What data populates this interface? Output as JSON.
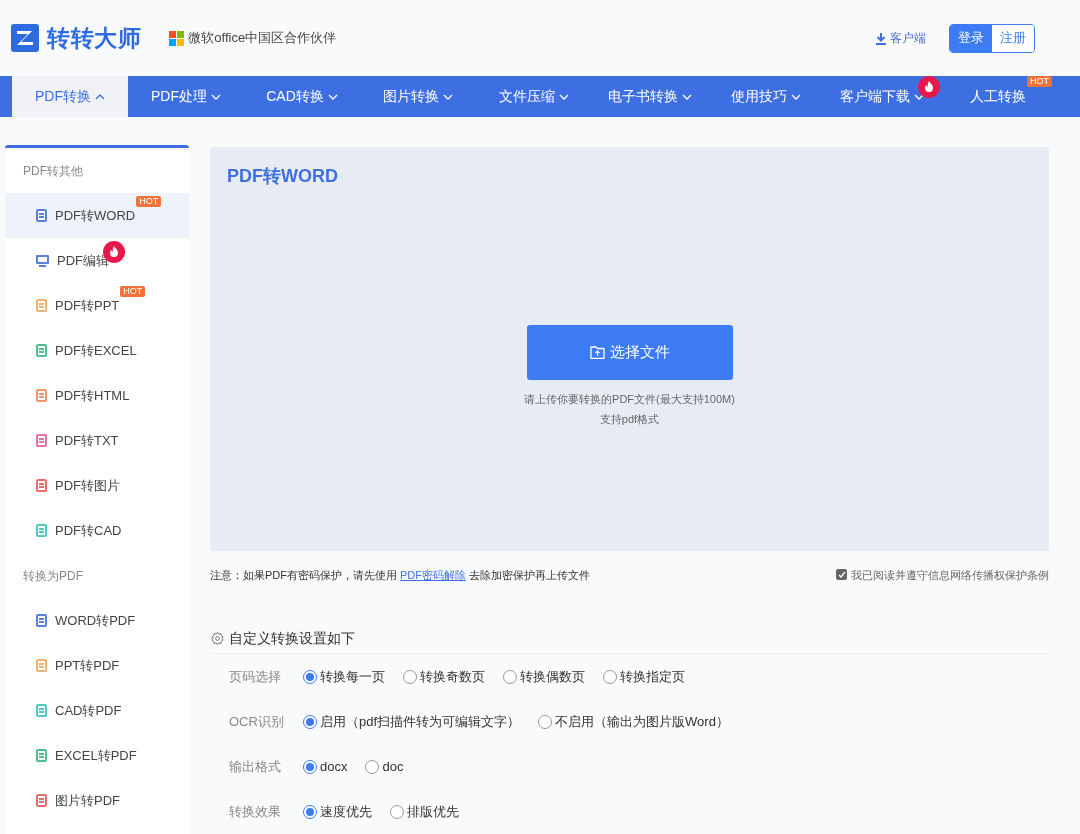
{
  "header": {
    "brand": "转转大师",
    "partner": "微软office中国区合作伙伴",
    "client_link": "客户端",
    "login": "登录",
    "register": "注册"
  },
  "nav": [
    {
      "label": "PDF转换",
      "selected": true,
      "expanded": true
    },
    {
      "label": "PDF处理",
      "selected": false,
      "expanded": false
    },
    {
      "label": "CAD转换",
      "selected": false,
      "expanded": false
    },
    {
      "label": "图片转换",
      "selected": false,
      "expanded": false
    },
    {
      "label": "文件压缩",
      "selected": false,
      "expanded": false
    },
    {
      "label": "电子书转换",
      "selected": false,
      "expanded": false
    },
    {
      "label": "使用技巧",
      "selected": false,
      "expanded": false
    },
    {
      "label": "客户端下载",
      "selected": false,
      "expanded": false,
      "badge": {
        "kind": "fire"
      }
    },
    {
      "label": "人工转换",
      "selected": false,
      "badge": {
        "kind": "hot",
        "text": "HOT"
      }
    }
  ],
  "sidebar": [
    {
      "title": "PDF转其他",
      "items": [
        {
          "label": "PDF转WORD",
          "selected": true,
          "kind": "doc",
          "color": "#5b7fe0",
          "badge": {
            "kind": "hot",
            "text": "HOT"
          }
        },
        {
          "label": "PDF编辑",
          "selected": false,
          "kind": "monitor",
          "color": "#5b7fe0",
          "badge": {
            "kind": "fire"
          }
        },
        {
          "label": "PDF转PPT",
          "selected": false,
          "kind": "doc",
          "color": "#f5b26b",
          "badge": {
            "kind": "hot",
            "text": "HOT"
          }
        },
        {
          "label": "PDF转EXCEL",
          "selected": false,
          "kind": "doc",
          "color": "#4cbf8c"
        },
        {
          "label": "PDF转HTML",
          "selected": false,
          "kind": "doc",
          "color": "#f0956a"
        },
        {
          "label": "PDF转TXT",
          "selected": false,
          "kind": "doc",
          "color": "#f06aa8"
        },
        {
          "label": "PDF转图片",
          "selected": false,
          "kind": "doc",
          "color": "#ef6b6b"
        },
        {
          "label": "PDF转CAD",
          "selected": false,
          "kind": "doc",
          "color": "#4cc9c0"
        }
      ]
    },
    {
      "title": "转换为PDF",
      "items": [
        {
          "label": "WORD转PDF",
          "selected": false,
          "kind": "doc",
          "color": "#5b7fe0"
        },
        {
          "label": "PPT转PDF",
          "selected": false,
          "kind": "doc",
          "color": "#f5b26b"
        },
        {
          "label": "CAD转PDF",
          "selected": false,
          "kind": "doc",
          "color": "#4cc9c0"
        },
        {
          "label": "EXCEL转PDF",
          "selected": false,
          "kind": "doc",
          "color": "#4cbf8c"
        },
        {
          "label": "图片转PDF",
          "selected": false,
          "kind": "doc",
          "color": "#ef6b6b"
        }
      ]
    }
  ],
  "upload": {
    "title": "PDF转WORD",
    "button": "选择文件",
    "hint": "请上传你要转换的PDF文件(最大支持100M)",
    "formats": "支持pdf格式"
  },
  "notice": {
    "before": "注意：如果PDF有密码保护，请先使用",
    "link": "PDF密码解除",
    "after": "去除加密保护再上传文件"
  },
  "agreement": {
    "label": "我已阅读并遵守信息网络传播权保护条例",
    "checked": true
  },
  "settings": {
    "title": "自定义转换设置如下",
    "rows": [
      {
        "label": "页码选择",
        "options": [
          {
            "label": "转换每一页",
            "selected": true
          },
          {
            "label": "转换奇数页",
            "selected": false
          },
          {
            "label": "转换偶数页",
            "selected": false
          },
          {
            "label": "转换指定页",
            "selected": false
          }
        ]
      },
      {
        "label": "OCR识别",
        "options": [
          {
            "label": "启用（pdf扫描件转为可编辑文字）",
            "selected": true
          },
          {
            "label": "不启用（输出为图片版Word）",
            "selected": false
          }
        ]
      },
      {
        "label": "输出格式",
        "options": [
          {
            "label": "docx",
            "selected": true
          },
          {
            "label": "doc",
            "selected": false
          }
        ]
      },
      {
        "label": "转换效果",
        "options": [
          {
            "label": "速度优先",
            "selected": true
          },
          {
            "label": "排版优先",
            "selected": false
          }
        ]
      }
    ]
  }
}
